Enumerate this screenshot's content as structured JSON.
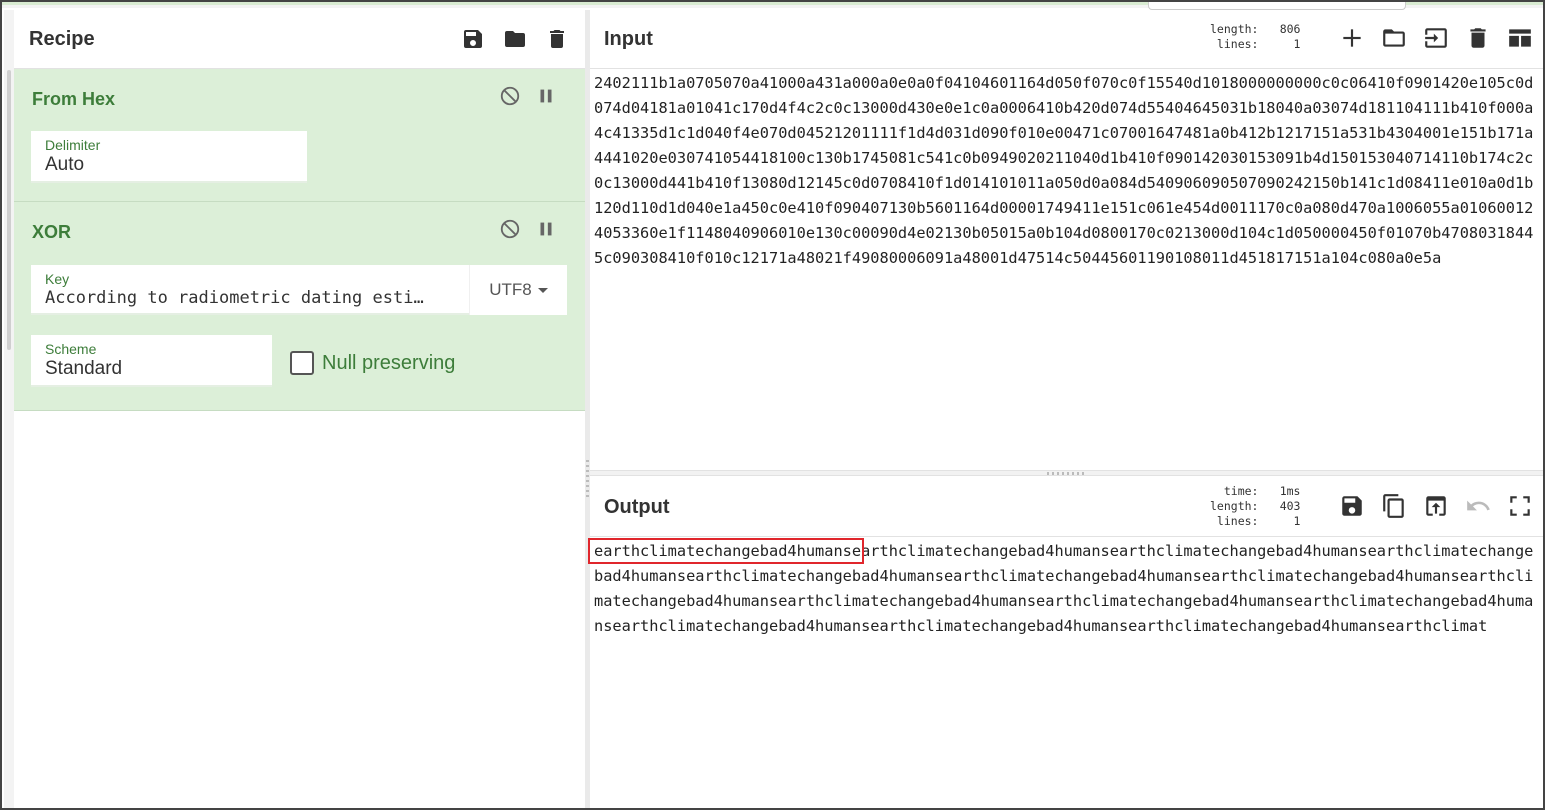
{
  "recipe": {
    "title": "Recipe",
    "icons": [
      "save-icon",
      "folder-icon",
      "trash-icon"
    ],
    "operations": [
      {
        "name": "From Hex",
        "fields": {
          "delimiter_label": "Delimiter",
          "delimiter_value": "Auto"
        }
      },
      {
        "name": "XOR",
        "fields": {
          "key_label": "Key",
          "key_value": "According to radiometric dating esti…",
          "key_encoding": "UTF8",
          "scheme_label": "Scheme",
          "scheme_value": "Standard",
          "null_preserving_label": "Null preserving",
          "null_preserving_checked": false
        }
      }
    ]
  },
  "input": {
    "title": "Input",
    "stats": {
      "length_label": "length:",
      "length_value": "806",
      "lines_label": "lines:",
      "lines_value": "1"
    },
    "text": "2402111b1a0705070a41000a431a000a0e0a0f04104601164d050f070c0f15540d1018000000000c0c06410f0901420e105c0d074d04181a01041c170d4f4c2c0c13000d430e0e1c0a0006410b420d074d55404645031b18040a03074d181104111b410f000a4c41335d1c1d040f4e070d04521201111f1d4d031d090f010e00471c07001647481a0b412b1217151a531b4304001e151b171a4441020e030741054418100c130b1745081c541c0b0949020211040d1b410f090142030153091b4d150153040714110b174c2c0c13000d441b410f13080d12145c0d0708410f1d014101011a050d0a084d540906090507090242150b141c1d08411e010a0d1b120d110d1d040e1a450c0e410f090407130b5601164d00001749411e151c061e454d0011170c0a080d470a1006055a010600124053360e1f1148040906010e130c00090d4e02130b05015a0b104d0800170c0213000d104c1d050000450f01070b47080318445c090308410f010c12171a48021f49080006091a48001d47514c50445601190108011d451817151a104c080a0e5a"
  },
  "output": {
    "title": "Output",
    "stats": {
      "time_label": "time:",
      "time_value": "1ms",
      "length_label": "length:",
      "length_value": "403",
      "lines_label": "lines:",
      "lines_value": "1"
    },
    "text": "earthclimatechangebad4humansearthclimatechangebad4humansearthclimatechangebad4humansearthclimatechangebad4humansearthclimatechangebad4humansearthclimatechangebad4humansearthclimatechangebad4humansearthclimatechangebad4humansearthclimatechangebad4humansearthclimatechangebad4humansearthclimatechangebad4humansearthclimatechangebad4humansearthclimatechangebad4humansearthclimatechangebad4humansearthclimat"
  },
  "colors": {
    "accent_green": "#3d7d3a",
    "op_bg": "#dcefd8",
    "highlight_red": "#e0262c"
  }
}
